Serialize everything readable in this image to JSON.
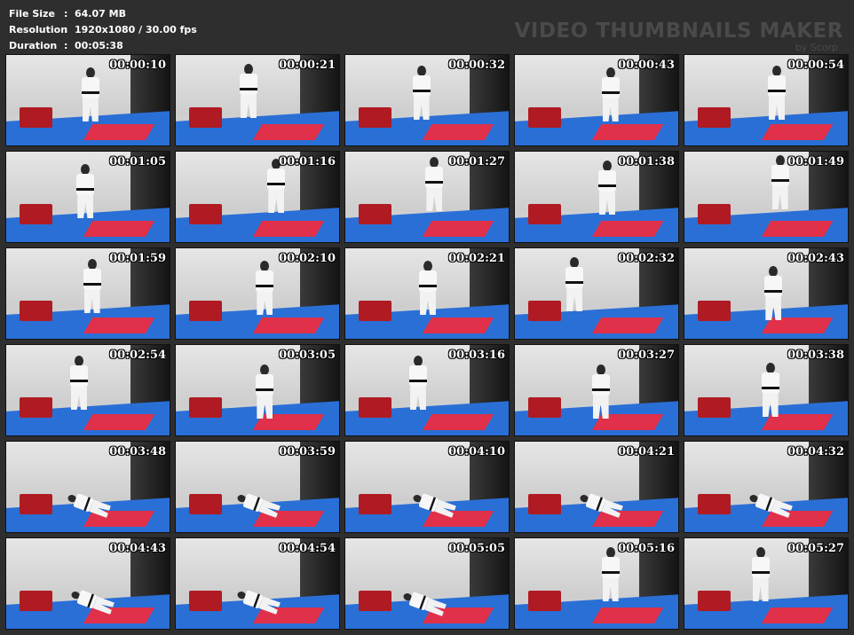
{
  "info": {
    "file_size_label": "File Size",
    "file_size_value": "64.07 MB",
    "resolution_label": "Resolution",
    "resolution_value": "1920x1080 / 30.00 fps",
    "duration_label": "Duration",
    "duration_value": "00:05:38",
    "separator": ":"
  },
  "brand": {
    "title": "VIDEO THUMBNAILS MAKER",
    "subtitle": "by Scorp"
  },
  "thumbnails": [
    {
      "time": "00:00:10"
    },
    {
      "time": "00:00:21"
    },
    {
      "time": "00:00:32"
    },
    {
      "time": "00:00:43"
    },
    {
      "time": "00:00:54"
    },
    {
      "time": "00:01:05"
    },
    {
      "time": "00:01:16"
    },
    {
      "time": "00:01:27"
    },
    {
      "time": "00:01:38"
    },
    {
      "time": "00:01:49"
    },
    {
      "time": "00:01:59"
    },
    {
      "time": "00:02:10"
    },
    {
      "time": "00:02:21"
    },
    {
      "time": "00:02:32"
    },
    {
      "time": "00:02:43"
    },
    {
      "time": "00:02:54"
    },
    {
      "time": "00:03:05"
    },
    {
      "time": "00:03:16"
    },
    {
      "time": "00:03:27"
    },
    {
      "time": "00:03:38"
    },
    {
      "time": "00:03:48"
    },
    {
      "time": "00:03:59"
    },
    {
      "time": "00:04:10"
    },
    {
      "time": "00:04:21"
    },
    {
      "time": "00:04:32"
    },
    {
      "time": "00:04:43"
    },
    {
      "time": "00:04:54"
    },
    {
      "time": "00:05:05"
    },
    {
      "time": "00:05:16"
    },
    {
      "time": "00:05:27"
    }
  ]
}
